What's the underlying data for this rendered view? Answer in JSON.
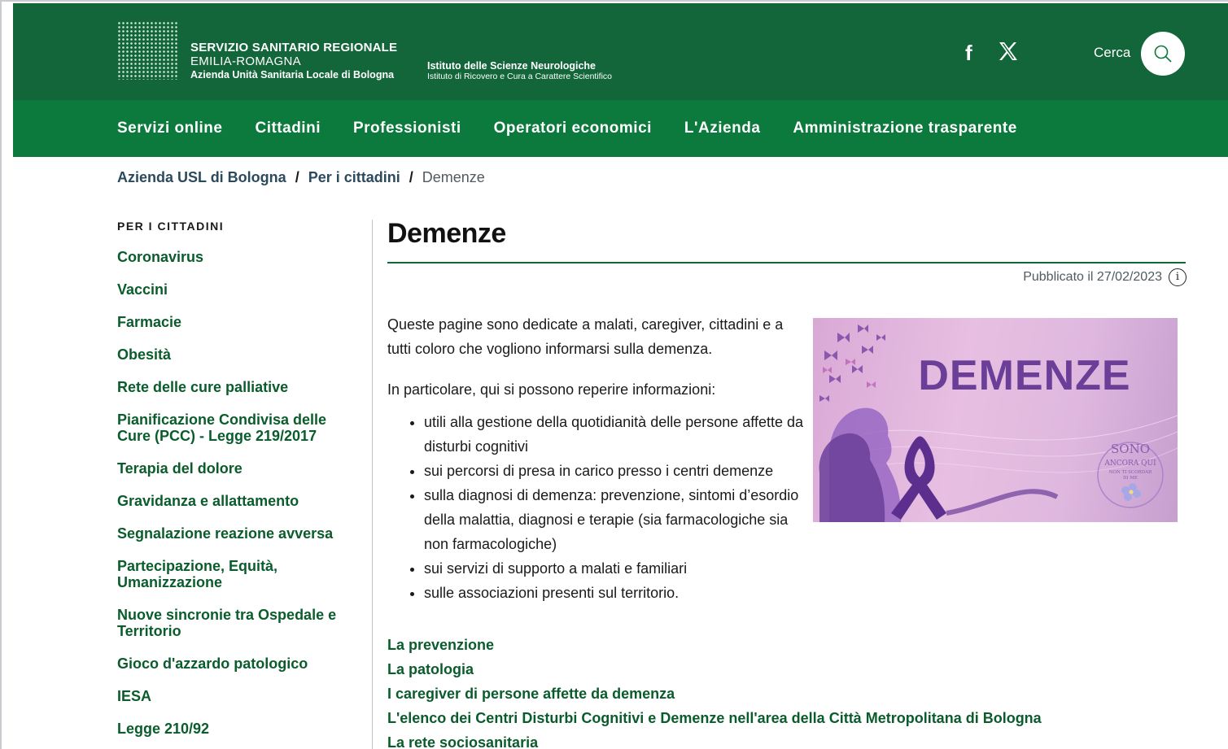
{
  "header": {
    "org_line1": "SERVIZIO SANITARIO REGIONALE",
    "org_line2": "EMILIA-ROMAGNA",
    "org_line3": "Azienda Unità Sanitaria Locale di Bologna",
    "inst_line1": "Istituto delle Scienze Neurologiche",
    "inst_line2": "Istituto di Ricovero e Cura a Carattere Scientifico",
    "facebook_glyph": "f",
    "x_glyph": "𝕏",
    "search_label": "Cerca"
  },
  "nav": {
    "items": [
      "Servizi online",
      "Cittadini",
      "Professionisti",
      "Operatori economici",
      "L'Azienda",
      "Amministrazione trasparente"
    ]
  },
  "breadcrumb": {
    "items": [
      "Azienda USL di Bologna",
      "Per i cittadini"
    ],
    "current": "Demenze",
    "separator": "/"
  },
  "sidebar": {
    "title": "PER I CITTADINI",
    "items": [
      "Coronavirus",
      "Vaccini",
      "Farmacie",
      "Obesità",
      "Rete delle cure palliative",
      "Pianificazione Condivisa delle Cure (PCC) - Legge 219/2017",
      "Terapia del dolore",
      "Gravidanza e allattamento",
      "Segnalazione reazione avversa",
      "Partecipazione, Equità, Umanizzazione",
      "Nuove sincronie tra Ospedale e Territorio",
      "Gioco d'azzardo patologico",
      "IESA",
      "Legge 210/92"
    ]
  },
  "main": {
    "title": "Demenze",
    "published": "Pubblicato il 27/02/2023",
    "info_glyph": "i",
    "intro": "Queste pagine sono dedicate a malati, caregiver, cittadini e a tutti coloro che vogliono informarsi sulla demenza.",
    "intro2": "In particolare, qui si possono reperire informazioni:",
    "bullets": [
      "utili alla gestione della quotidianità delle persone affette da disturbi cognitivi",
      "sui percorsi di presa in carico presso i centri demenze",
      "sulla diagnosi di demenza: prevenzione, sintomi d’esordio della malattia, diagnosi e terapie (sia farmacologiche sia non farmacologiche)",
      "sui servizi di supporto a malati e familiari",
      "sulle associazioni presenti sul territorio."
    ],
    "hero_title": "DEMENZE",
    "hero_badge_line1": "SONO",
    "hero_badge_line2": "ANCORA QUI",
    "hero_badge_line3": "NON TI SCORDAR",
    "hero_badge_line4": "DI ME",
    "links": [
      "La prevenzione",
      "La patologia",
      "I caregiver di persone affette da demenza",
      "L'elenco dei Centri Disturbi Cognitivi e Demenze nell'area della Città Metropolitana di Bologna",
      "La rete sociosanitaria"
    ]
  },
  "colors": {
    "header_bg": "#13653a",
    "nav_bg": "#0c7a3c",
    "link_green": "#0b5c2c",
    "hero_purple": "#6b3f98"
  }
}
